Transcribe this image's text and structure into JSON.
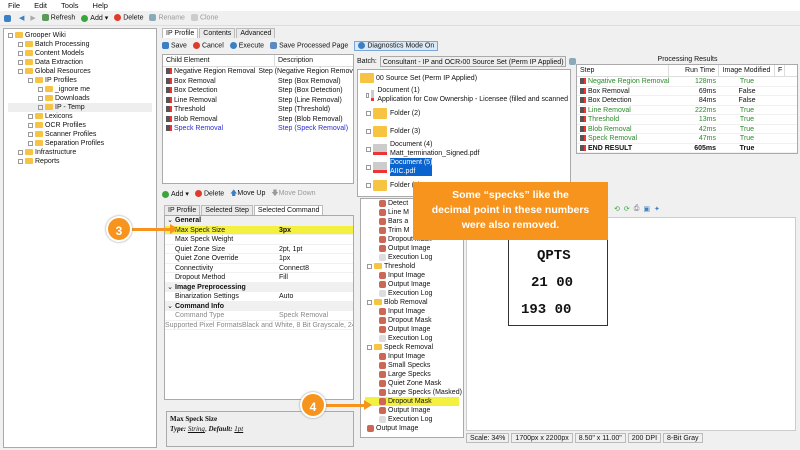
{
  "menu": [
    "File",
    "Edit",
    "Tools",
    "Help"
  ],
  "toolbar": {
    "refresh": "Refresh",
    "add": "Add",
    "delete": "Delete",
    "rename": "Rename",
    "clone": "Clone"
  },
  "nav_tree": [
    {
      "label": "Grooper Wiki",
      "lvl": 0
    },
    {
      "label": "Batch Processing",
      "lvl": 1
    },
    {
      "label": "Content Models",
      "lvl": 1
    },
    {
      "label": "Data Extraction",
      "lvl": 1
    },
    {
      "label": "Global Resources",
      "lvl": 1
    },
    {
      "label": "IP Profiles",
      "lvl": 2
    },
    {
      "label": "_ignore me",
      "lvl": 3
    },
    {
      "label": "Downloads",
      "lvl": 3
    },
    {
      "label": "IP - Temp",
      "lvl": 3
    },
    {
      "label": "Lexicons",
      "lvl": 2
    },
    {
      "label": "OCR Profiles",
      "lvl": 2
    },
    {
      "label": "Scanner Profiles",
      "lvl": 2
    },
    {
      "label": "Separation Profiles",
      "lvl": 2
    },
    {
      "label": "Infrastructure",
      "lvl": 1
    },
    {
      "label": "Reports",
      "lvl": 1
    }
  ],
  "editor": {
    "tabs": [
      "IP Profile",
      "Contents",
      "Advanced"
    ],
    "toolbar": {
      "save": "Save",
      "cancel": "Cancel",
      "execute": "Execute",
      "save_page": "Save Processed Page",
      "diagnostics": "Diagnostics Mode On"
    },
    "grid_headers": [
      "Child Element",
      "Description"
    ],
    "steps": [
      [
        "Negative Region Removal",
        "Step (Negative Region Removal)"
      ],
      [
        "Box Removal",
        "Step (Box Removal)"
      ],
      [
        "Box Detection",
        "Step (Box Detection)"
      ],
      [
        "Line Removal",
        "Step (Line Removal)"
      ],
      [
        "Threshold",
        "Step (Threshold)"
      ],
      [
        "Blob Removal",
        "Step (Blob Removal)"
      ],
      [
        "Speck Removal",
        "Step (Speck Removal)"
      ]
    ],
    "cmd_toolbar": {
      "add": "Add",
      "delete": "Delete",
      "move_up": "Move Up",
      "move_down": "Move Down"
    },
    "cmd_tabs": [
      "IP Profile",
      "Selected Step",
      "Selected Command"
    ],
    "props": [
      {
        "cat": "General"
      },
      {
        "k": "Max Speck Size",
        "v": "3px",
        "hl": true
      },
      {
        "k": "Max Speck Weight",
        "v": ""
      },
      {
        "k": "Quiet Zone Size",
        "v": "2pt, 1pt"
      },
      {
        "k": "Quiet Zone Override",
        "v": "1px"
      },
      {
        "k": "Connectivity",
        "v": "Connect8"
      },
      {
        "k": "Dropout Method",
        "v": "Fill"
      },
      {
        "cat": "Image Preprocessing"
      },
      {
        "k": "Binarization Settings",
        "v": "Auto"
      },
      {
        "cat": "Command Info"
      },
      {
        "k": "Command Type",
        "v": "Speck Removal",
        "dim": true
      },
      {
        "k": "Supported Pixel Formats",
        "v": "Black and White, 8 Bit Grayscale, 24",
        "dim": true
      }
    ],
    "help": {
      "title": "Max Speck Size",
      "type_label": "Type:",
      "type": "String",
      "default_label": "Default:",
      "default": "1pt"
    }
  },
  "batch": {
    "label": "Batch:",
    "value": "Consultant - IP and OCR›00 Source Set (Perm IP Applied)",
    "root": "00 Source Set (Perm IP Applied)",
    "items": [
      {
        "t": "Document (1)",
        "s": "Application for Cow Ownership - Licensee (filled and scanned"
      },
      {
        "t": "Folder (2)"
      },
      {
        "t": "Folder (3)"
      },
      {
        "t": "Document (4)",
        "s": "Matt_termination_Signed.pdf"
      },
      {
        "t": "Document (5)",
        "s": "AIIC.pdf",
        "sel": true
      },
      {
        "t": "Folder (6)"
      }
    ]
  },
  "diag_tree": [
    {
      "t": "Detect",
      "l": 2
    },
    {
      "t": "Line M",
      "l": 2
    },
    {
      "t": "Bars a",
      "l": 2
    },
    {
      "t": "Trim M",
      "l": 2
    },
    {
      "t": "Dropout Mask",
      "l": 2
    },
    {
      "t": "Output Image",
      "l": 2
    },
    {
      "t": "Execution Log",
      "l": 2,
      "log": true
    },
    {
      "t": "Threshold",
      "l": 1,
      "f": true
    },
    {
      "t": "Input Image",
      "l": 2
    },
    {
      "t": "Output Image",
      "l": 2
    },
    {
      "t": "Execution Log",
      "l": 2,
      "log": true
    },
    {
      "t": "Blob Removal",
      "l": 1,
      "f": true
    },
    {
      "t": "Input Image",
      "l": 2
    },
    {
      "t": "Dropout Mask",
      "l": 2
    },
    {
      "t": "Output Image",
      "l": 2
    },
    {
      "t": "Execution Log",
      "l": 2,
      "log": true
    },
    {
      "t": "Speck Removal",
      "l": 1,
      "f": true
    },
    {
      "t": "Input Image",
      "l": 2
    },
    {
      "t": "Small Specks",
      "l": 2
    },
    {
      "t": "Large Specks",
      "l": 2
    },
    {
      "t": "Quiet Zone Mask",
      "l": 2
    },
    {
      "t": "Large Specks (Masked)",
      "l": 2
    },
    {
      "t": "Dropout Mask",
      "l": 2,
      "hl": true
    },
    {
      "t": "Output Image",
      "l": 2
    },
    {
      "t": "Execution Log",
      "l": 2,
      "log": true
    },
    {
      "t": "Output Image",
      "l": 1
    }
  ],
  "results": {
    "title": "Processing Results",
    "headers": [
      "Step",
      "Run Time",
      "Image Modified",
      "F"
    ],
    "rows": [
      [
        "Negative Region Removal",
        "128ms",
        "True",
        "g"
      ],
      [
        "Box Removal",
        "69ms",
        "False",
        ""
      ],
      [
        "Box Detection",
        "84ms",
        "False",
        ""
      ],
      [
        "Line Removal",
        "222ms",
        "True",
        "g"
      ],
      [
        "Threshold",
        "13ms",
        "True",
        "g"
      ],
      [
        "Blob Removal",
        "42ms",
        "True",
        "g"
      ],
      [
        "Speck Removal",
        "47ms",
        "True",
        "g"
      ],
      [
        "END RESULT",
        "605ms",
        "True",
        "bold"
      ]
    ]
  },
  "status": [
    "Scale: 34%",
    "1700px x 2200px",
    "8.50\" x 11.00\"",
    "200 DPI",
    "8-Bit Gray"
  ],
  "callout": {
    "line1": "Some “specks” like the",
    "line2": "decimal point in these numbers",
    "line3": "were also removed."
  },
  "inset": [
    "QPTS",
    "21 00",
    "193 00"
  ],
  "markers": [
    "3",
    "4"
  ]
}
